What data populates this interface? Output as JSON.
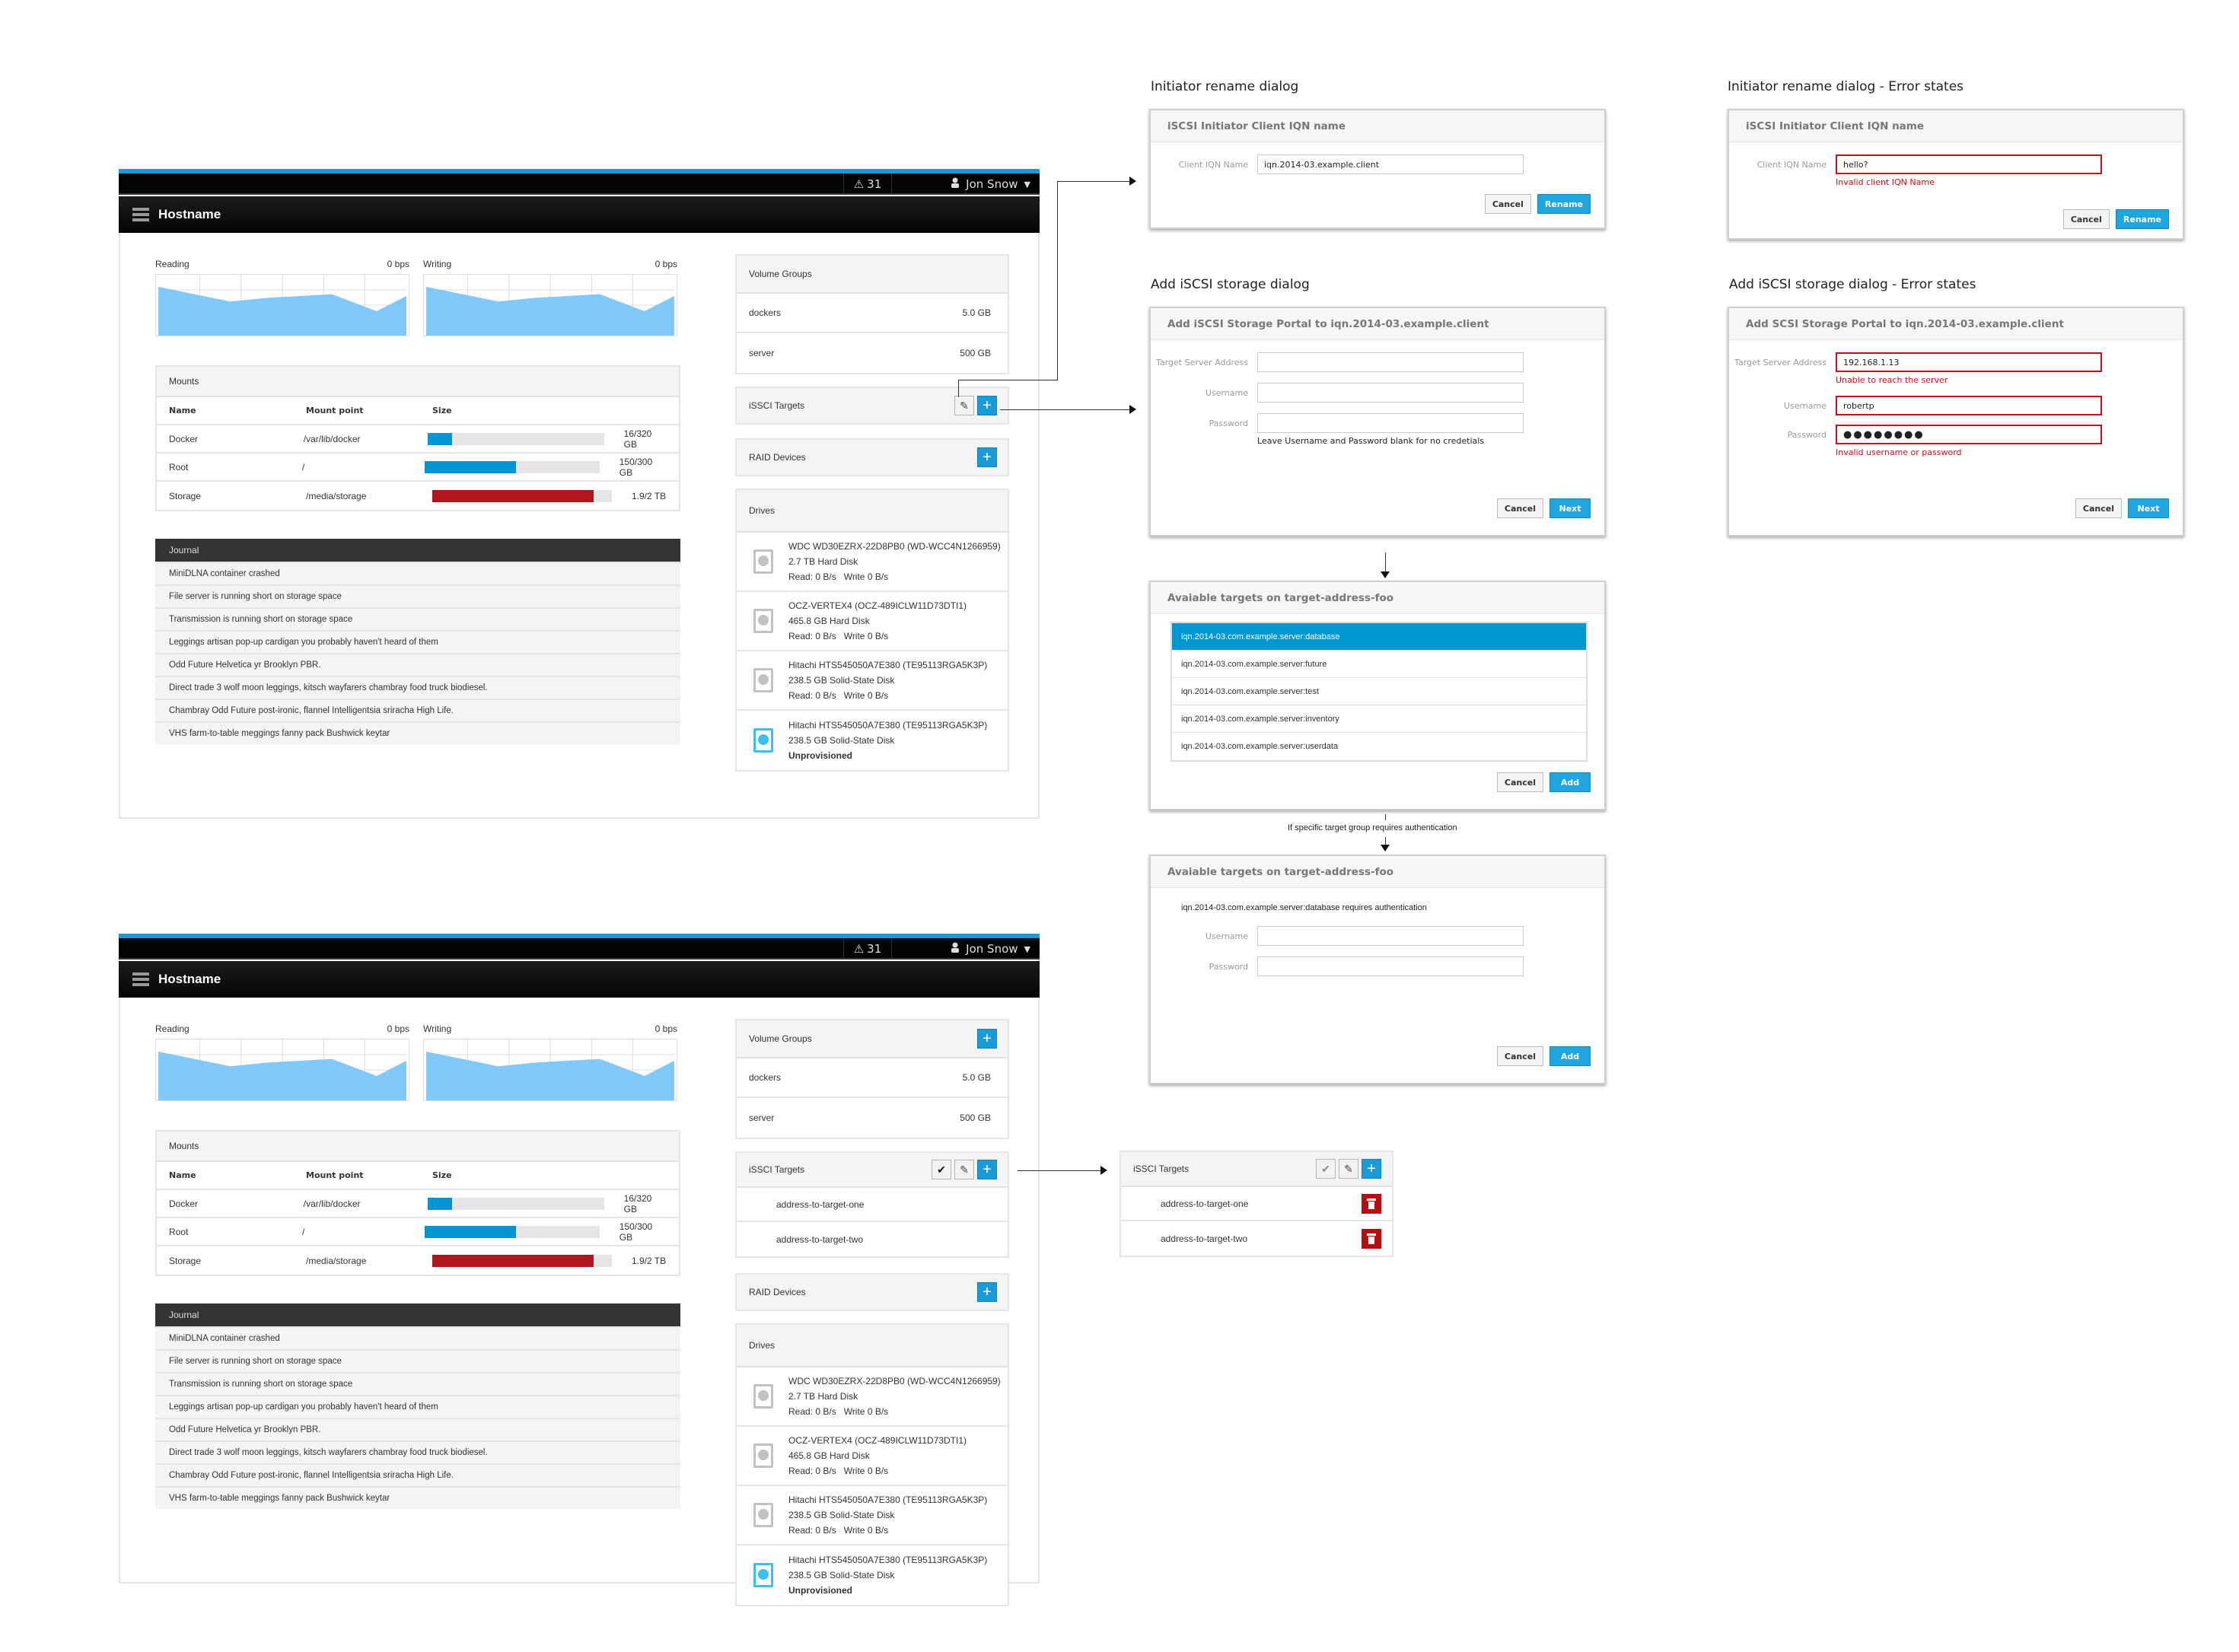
{
  "dashboard": {
    "alert_count": "31",
    "user_name": "Jon Snow",
    "hostname": "Hostname",
    "reading": {
      "label": "Reading",
      "value": "0 bps"
    },
    "writing": {
      "label": "Writing",
      "value": "0 bps"
    },
    "sparkline_values": [
      0.8,
      0.56,
      0.62,
      0.68,
      0.4,
      0.65
    ],
    "mounts": {
      "title": "Mounts",
      "headers": [
        "Name",
        "Mount point",
        "Size"
      ],
      "rows": [
        {
          "name": "Docker",
          "mount_point": "/var/lib/docker",
          "usage": "16/320 GB",
          "fraction": 0.14,
          "color": "#0096d6"
        },
        {
          "name": "Root",
          "mount_point": "/",
          "usage": "150/300 GB",
          "fraction": 0.52,
          "color": "#0096d6"
        },
        {
          "name": "Storage",
          "mount_point": "/media/storage",
          "usage": "1.9/2 TB",
          "fraction": 0.9,
          "color": "#b0161d"
        }
      ]
    },
    "journal": {
      "title": "Journal",
      "items": [
        "MiniDLNA container crashed",
        "File server is running short on storage space",
        "Transmission is running short on storage space",
        "Leggings artisan pop-up cardigan you probably haven't heard of them",
        "Odd Future Helvetica yr Brooklyn PBR.",
        "Direct trade 3 wolf moon leggings, kitsch wayfarers chambray food truck biodiesel.",
        "Chambray Odd Future post-ironic, flannel Intelligentsia sriracha High Life.",
        "VHS farm-to-table meggings fanny pack Bushwick keytar"
      ]
    },
    "volume_groups": {
      "title": "Volume Groups",
      "items": [
        {
          "name": "dockers",
          "size": "5.0 GB"
        },
        {
          "name": "server",
          "size": "500 GB"
        }
      ]
    },
    "iscsi_targets": {
      "title": "iSSCI Targets",
      "items": [
        "address-to-target-one",
        "address-to-target-two"
      ]
    },
    "raid": {
      "title": "RAID Devices"
    },
    "drives": {
      "title": "Drives",
      "items": [
        {
          "name": "WDC WD30EZRX-22D8PB0 (WD-WCC4N1266959)",
          "type": "2.7 TB Hard Disk",
          "status": "Read: 0 B/s   Write 0 B/s",
          "active": false
        },
        {
          "name": "OCZ-VERTEX4 (OCZ-489ICLW11D73DTI1)",
          "type": "465.8 GB Hard Disk",
          "status": "Read: 0 B/s   Write 0 B/s",
          "active": false
        },
        {
          "name": "Hitachi HTS545050A7E380 (TE95113RGA5K3P)",
          "type": "238.5 GB Solid-State Disk",
          "status": "Read: 0 B/s   Write 0 B/s",
          "active": false
        },
        {
          "name": "Hitachi HTS545050A7E380 (TE95113RGA5K3P)",
          "type": "238.5 GB Solid-State Disk",
          "status": "Unprovisioned",
          "active": true
        }
      ]
    }
  },
  "rename_dialog": {
    "caption": "Initiator rename dialog",
    "title": "iSCSI Initiator Client IQN name",
    "label": "Client IQN Name",
    "value": "iqn.2014-03.example.client",
    "cancel": "Cancel",
    "confirm": "Rename"
  },
  "rename_dialog_error": {
    "caption": "Initiator rename dialog - Error states",
    "title": "iSCSI Initiator Client IQN name",
    "label": "Client IQN Name",
    "value": "hello?",
    "error": "Invalid client IQN Name",
    "cancel": "Cancel",
    "confirm": "Rename"
  },
  "add_dialog": {
    "caption": "Add iSCSI storage dialog",
    "title": "Add iSCSI Storage Portal to iqn.2014-03.example.client",
    "address_label": "Target Server Address",
    "address_value": "",
    "username_label": "Username",
    "username_value": "",
    "password_label": "Password",
    "password_value": "",
    "hint": "Leave Username and Password blank for no credetials",
    "cancel": "Cancel",
    "confirm": "Next"
  },
  "add_dialog_error": {
    "caption": "Add iSCSI storage dialog - Error states",
    "title": "Add SCSI Storage Portal to iqn.2014-03.example.client",
    "address_label": "Target Server Address",
    "address_value": "192.168.1.13",
    "address_error": "Unable to reach the server",
    "username_label": "Username",
    "username_value": "robertp",
    "password_label": "Password",
    "password_value": "●●●●●●●●",
    "password_error": "Invalid username or password",
    "cancel": "Cancel",
    "confirm": "Next"
  },
  "targets_dialog": {
    "title": "Avaiable targets on target-address-foo",
    "targets": [
      "iqn.2014-03.com.example.server:database",
      "iqn.2014-03.com.example.server:future",
      "iqn.2014-03.com.example.server:test",
      "iqn.2014-03.com.example.server:inventory",
      "iqn.2014-03.com.example.server:userdata"
    ],
    "selected_index": 0,
    "cancel": "Cancel",
    "confirm": "Add"
  },
  "flow_note": "If specific target group requires authentication",
  "auth_dialog": {
    "title": "Avaiable targets on target-address-foo",
    "message": "iqn.2014-03.com.example.server:database requires authentication",
    "username_label": "Username",
    "password_label": "Password",
    "cancel": "Cancel",
    "confirm": "Add"
  },
  "icons": {
    "alert": "⚠",
    "user": "👤",
    "caret": "▼",
    "plus": "+",
    "pencil": "✎",
    "check": "✔"
  },
  "colors": {
    "accent": "#1a9ad6",
    "danger": "#b0161d",
    "chart_fill": "#7ac5fb"
  }
}
